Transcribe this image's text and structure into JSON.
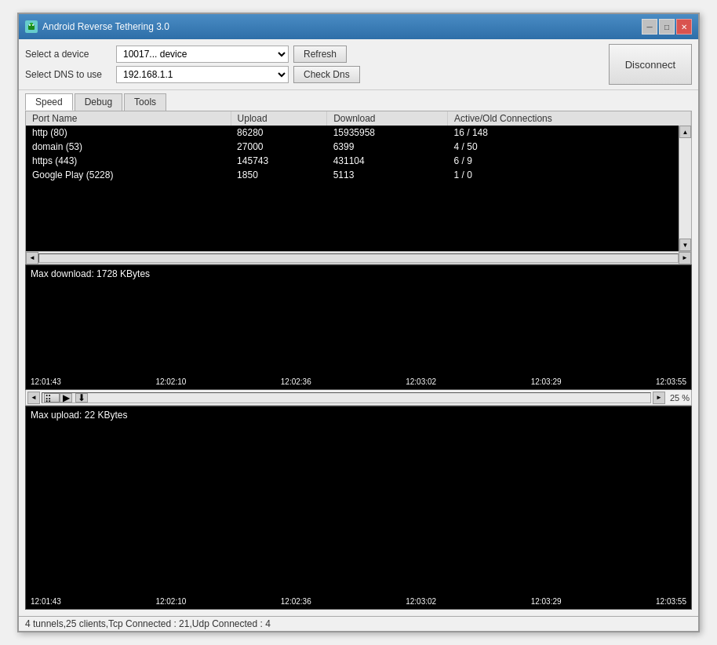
{
  "window": {
    "title": "Android Reverse Tethering 3.0",
    "title_icon_color": "#55cccc"
  },
  "title_controls": {
    "minimize": "─",
    "restore": "□",
    "close": "✕"
  },
  "toolbar": {
    "device_label": "Select a device",
    "device_value": "10017... device",
    "device_placeholder": "10017... device",
    "refresh_label": "Refresh",
    "dns_label": "Select DNS to use",
    "dns_value": "192.168.1.1",
    "check_dns_label": "Check Dns",
    "disconnect_label": "Disconnect"
  },
  "tabs": [
    {
      "label": "Speed",
      "active": true
    },
    {
      "label": "Debug",
      "active": false
    },
    {
      "label": "Tools",
      "active": false
    }
  ],
  "table": {
    "headers": [
      "Port Name",
      "Upload",
      "Download",
      "Active/Old Connections"
    ],
    "rows": [
      {
        "port": "http (80)",
        "upload": "86280",
        "download": "15935958",
        "connections": "16 / 148"
      },
      {
        "port": "domain (53)",
        "upload": "27000",
        "download": "6399",
        "connections": "4 / 50"
      },
      {
        "port": "https (443)",
        "upload": "145743",
        "download": "431104",
        "connections": "6 / 9"
      },
      {
        "port": "Google Play (5228)",
        "upload": "1850",
        "download": "5113",
        "connections": "1 / 0"
      }
    ]
  },
  "download_chart": {
    "label": "Max download: 1728 KBytes",
    "timestamps": [
      "12:01:43",
      "12:02:10",
      "12:02:36",
      "12:03:02",
      "12:03:29",
      "12:03:55"
    ],
    "color": "#ff2222",
    "zoom": "25 %"
  },
  "upload_chart": {
    "label": "Max upload: 22 KBytes",
    "timestamps": [
      "12:01:43",
      "12:02:10",
      "12:02:36",
      "12:03:02",
      "12:03:29",
      "12:03:55"
    ],
    "color": "#22dd22"
  },
  "status_bar": {
    "text": "4 tunnels,25 clients,Tcp Connected : 21,Udp Connected : 4"
  }
}
